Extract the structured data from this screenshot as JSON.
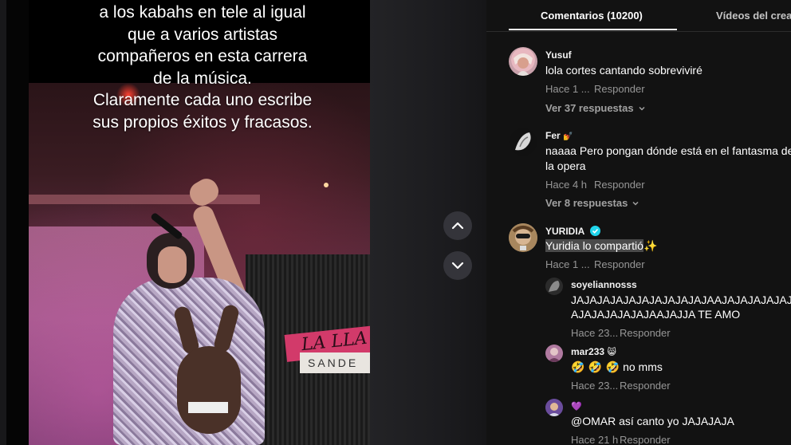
{
  "video": {
    "caption_lines": [
      "a los kabahs en tele al igual",
      "que a varios artistas",
      "compañeros en esta carrera",
      "de la música.",
      "Claramente cada uno escribe",
      "sus propios éxitos y fracasos."
    ],
    "sign_text": "LA LLA",
    "sign2_text": "SANDE"
  },
  "tabs": {
    "comments": "Comentarios (10200)",
    "videos": "Vídeos del creador"
  },
  "comments": [
    {
      "username": "Yusuf",
      "text_lines": [
        "lola cortes cantando sobreviviré"
      ],
      "time": "Hace 1 ...",
      "reply_label": "Responder",
      "more_replies": "Ver 37 respuestas"
    },
    {
      "username": "Fer",
      "username_emoji": "💅",
      "text_lines": [
        "naaaa Pero pongan dónde está en el fantasma de",
        "la opera"
      ],
      "time": "Hace 4 h",
      "reply_label": "Responder",
      "more_replies": "Ver 8 respuestas"
    },
    {
      "username": "YURIDIA",
      "text_highlight": "Yuridia lo compartió",
      "text_emoji": "✨",
      "time": "Hace 1 ...",
      "reply_label": "Responder"
    }
  ],
  "replies": [
    {
      "username": "soyeliannosss",
      "text_lines": [
        "JAJAJAJAJAJAJAJAJAJAJAAJAJAJAJAJAJAJAJAJAJ",
        "AJAJAJAJAJAJAAJAJJA TE AMO"
      ],
      "time": "Hace 23...",
      "reply_label": "Responder"
    },
    {
      "username": "mar233",
      "username_emoji": "😸",
      "text_emojis": "🤣 🤣 🤣",
      "text": "no mms",
      "time": "Hace 23...",
      "reply_label": "Responder"
    },
    {
      "username_emoji": "💜",
      "text": "@OMAR así canto yo JAJAJAJA",
      "time": "Hace 21 h",
      "reply_label": "Responder"
    }
  ],
  "colors": {
    "panel_bg": "#121212",
    "verified": "#20d5ec",
    "highlight": "#4a4a4a"
  },
  "icons": [
    "chevron-up-icon",
    "chevron-down-icon",
    "verified-badge-icon"
  ]
}
